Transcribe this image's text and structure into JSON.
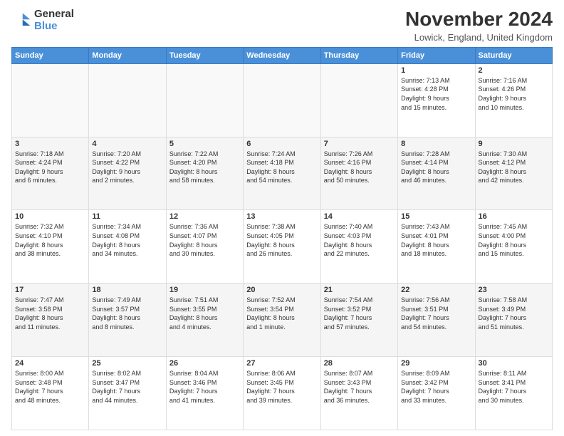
{
  "logo": {
    "line1": "General",
    "line2": "Blue"
  },
  "title": "November 2024",
  "subtitle": "Lowick, England, United Kingdom",
  "days_of_week": [
    "Sunday",
    "Monday",
    "Tuesday",
    "Wednesday",
    "Thursday",
    "Friday",
    "Saturday"
  ],
  "weeks": [
    [
      {
        "day": "",
        "info": ""
      },
      {
        "day": "",
        "info": ""
      },
      {
        "day": "",
        "info": ""
      },
      {
        "day": "",
        "info": ""
      },
      {
        "day": "",
        "info": ""
      },
      {
        "day": "1",
        "info": "Sunrise: 7:13 AM\nSunset: 4:28 PM\nDaylight: 9 hours\nand 15 minutes."
      },
      {
        "day": "2",
        "info": "Sunrise: 7:16 AM\nSunset: 4:26 PM\nDaylight: 9 hours\nand 10 minutes."
      }
    ],
    [
      {
        "day": "3",
        "info": "Sunrise: 7:18 AM\nSunset: 4:24 PM\nDaylight: 9 hours\nand 6 minutes."
      },
      {
        "day": "4",
        "info": "Sunrise: 7:20 AM\nSunset: 4:22 PM\nDaylight: 9 hours\nand 2 minutes."
      },
      {
        "day": "5",
        "info": "Sunrise: 7:22 AM\nSunset: 4:20 PM\nDaylight: 8 hours\nand 58 minutes."
      },
      {
        "day": "6",
        "info": "Sunrise: 7:24 AM\nSunset: 4:18 PM\nDaylight: 8 hours\nand 54 minutes."
      },
      {
        "day": "7",
        "info": "Sunrise: 7:26 AM\nSunset: 4:16 PM\nDaylight: 8 hours\nand 50 minutes."
      },
      {
        "day": "8",
        "info": "Sunrise: 7:28 AM\nSunset: 4:14 PM\nDaylight: 8 hours\nand 46 minutes."
      },
      {
        "day": "9",
        "info": "Sunrise: 7:30 AM\nSunset: 4:12 PM\nDaylight: 8 hours\nand 42 minutes."
      }
    ],
    [
      {
        "day": "10",
        "info": "Sunrise: 7:32 AM\nSunset: 4:10 PM\nDaylight: 8 hours\nand 38 minutes."
      },
      {
        "day": "11",
        "info": "Sunrise: 7:34 AM\nSunset: 4:08 PM\nDaylight: 8 hours\nand 34 minutes."
      },
      {
        "day": "12",
        "info": "Sunrise: 7:36 AM\nSunset: 4:07 PM\nDaylight: 8 hours\nand 30 minutes."
      },
      {
        "day": "13",
        "info": "Sunrise: 7:38 AM\nSunset: 4:05 PM\nDaylight: 8 hours\nand 26 minutes."
      },
      {
        "day": "14",
        "info": "Sunrise: 7:40 AM\nSunset: 4:03 PM\nDaylight: 8 hours\nand 22 minutes."
      },
      {
        "day": "15",
        "info": "Sunrise: 7:43 AM\nSunset: 4:01 PM\nDaylight: 8 hours\nand 18 minutes."
      },
      {
        "day": "16",
        "info": "Sunrise: 7:45 AM\nSunset: 4:00 PM\nDaylight: 8 hours\nand 15 minutes."
      }
    ],
    [
      {
        "day": "17",
        "info": "Sunrise: 7:47 AM\nSunset: 3:58 PM\nDaylight: 8 hours\nand 11 minutes."
      },
      {
        "day": "18",
        "info": "Sunrise: 7:49 AM\nSunset: 3:57 PM\nDaylight: 8 hours\nand 8 minutes."
      },
      {
        "day": "19",
        "info": "Sunrise: 7:51 AM\nSunset: 3:55 PM\nDaylight: 8 hours\nand 4 minutes."
      },
      {
        "day": "20",
        "info": "Sunrise: 7:52 AM\nSunset: 3:54 PM\nDaylight: 8 hours\nand 1 minute."
      },
      {
        "day": "21",
        "info": "Sunrise: 7:54 AM\nSunset: 3:52 PM\nDaylight: 7 hours\nand 57 minutes."
      },
      {
        "day": "22",
        "info": "Sunrise: 7:56 AM\nSunset: 3:51 PM\nDaylight: 7 hours\nand 54 minutes."
      },
      {
        "day": "23",
        "info": "Sunrise: 7:58 AM\nSunset: 3:49 PM\nDaylight: 7 hours\nand 51 minutes."
      }
    ],
    [
      {
        "day": "24",
        "info": "Sunrise: 8:00 AM\nSunset: 3:48 PM\nDaylight: 7 hours\nand 48 minutes."
      },
      {
        "day": "25",
        "info": "Sunrise: 8:02 AM\nSunset: 3:47 PM\nDaylight: 7 hours\nand 44 minutes."
      },
      {
        "day": "26",
        "info": "Sunrise: 8:04 AM\nSunset: 3:46 PM\nDaylight: 7 hours\nand 41 minutes."
      },
      {
        "day": "27",
        "info": "Sunrise: 8:06 AM\nSunset: 3:45 PM\nDaylight: 7 hours\nand 39 minutes."
      },
      {
        "day": "28",
        "info": "Sunrise: 8:07 AM\nSunset: 3:43 PM\nDaylight: 7 hours\nand 36 minutes."
      },
      {
        "day": "29",
        "info": "Sunrise: 8:09 AM\nSunset: 3:42 PM\nDaylight: 7 hours\nand 33 minutes."
      },
      {
        "day": "30",
        "info": "Sunrise: 8:11 AM\nSunset: 3:41 PM\nDaylight: 7 hours\nand 30 minutes."
      }
    ]
  ]
}
